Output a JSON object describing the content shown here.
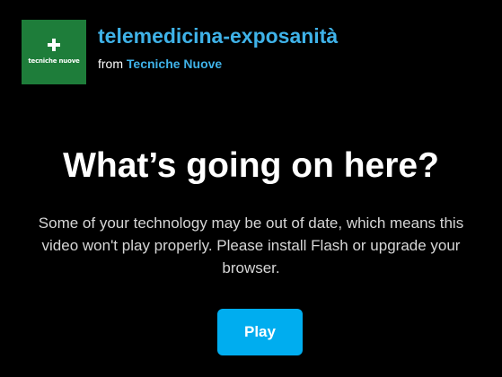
{
  "video": {
    "title": "telemedicina-exposanità",
    "byline_prefix": "from",
    "owner": "Tecniche Nuove",
    "portrait_text": "tecniche nuove",
    "portrait_icon": "cross-plus-icon"
  },
  "notice": {
    "headline": "What’s going on here?",
    "message": "Some of your technology may be out of date, which means this video won't play properly. Please install Flash or upgrade your browser.",
    "play_label": "Play"
  },
  "colors": {
    "background": "#000000",
    "accent": "#3fb2e8",
    "button": "#00adef",
    "portrait_bg": "#1e7d3a"
  }
}
